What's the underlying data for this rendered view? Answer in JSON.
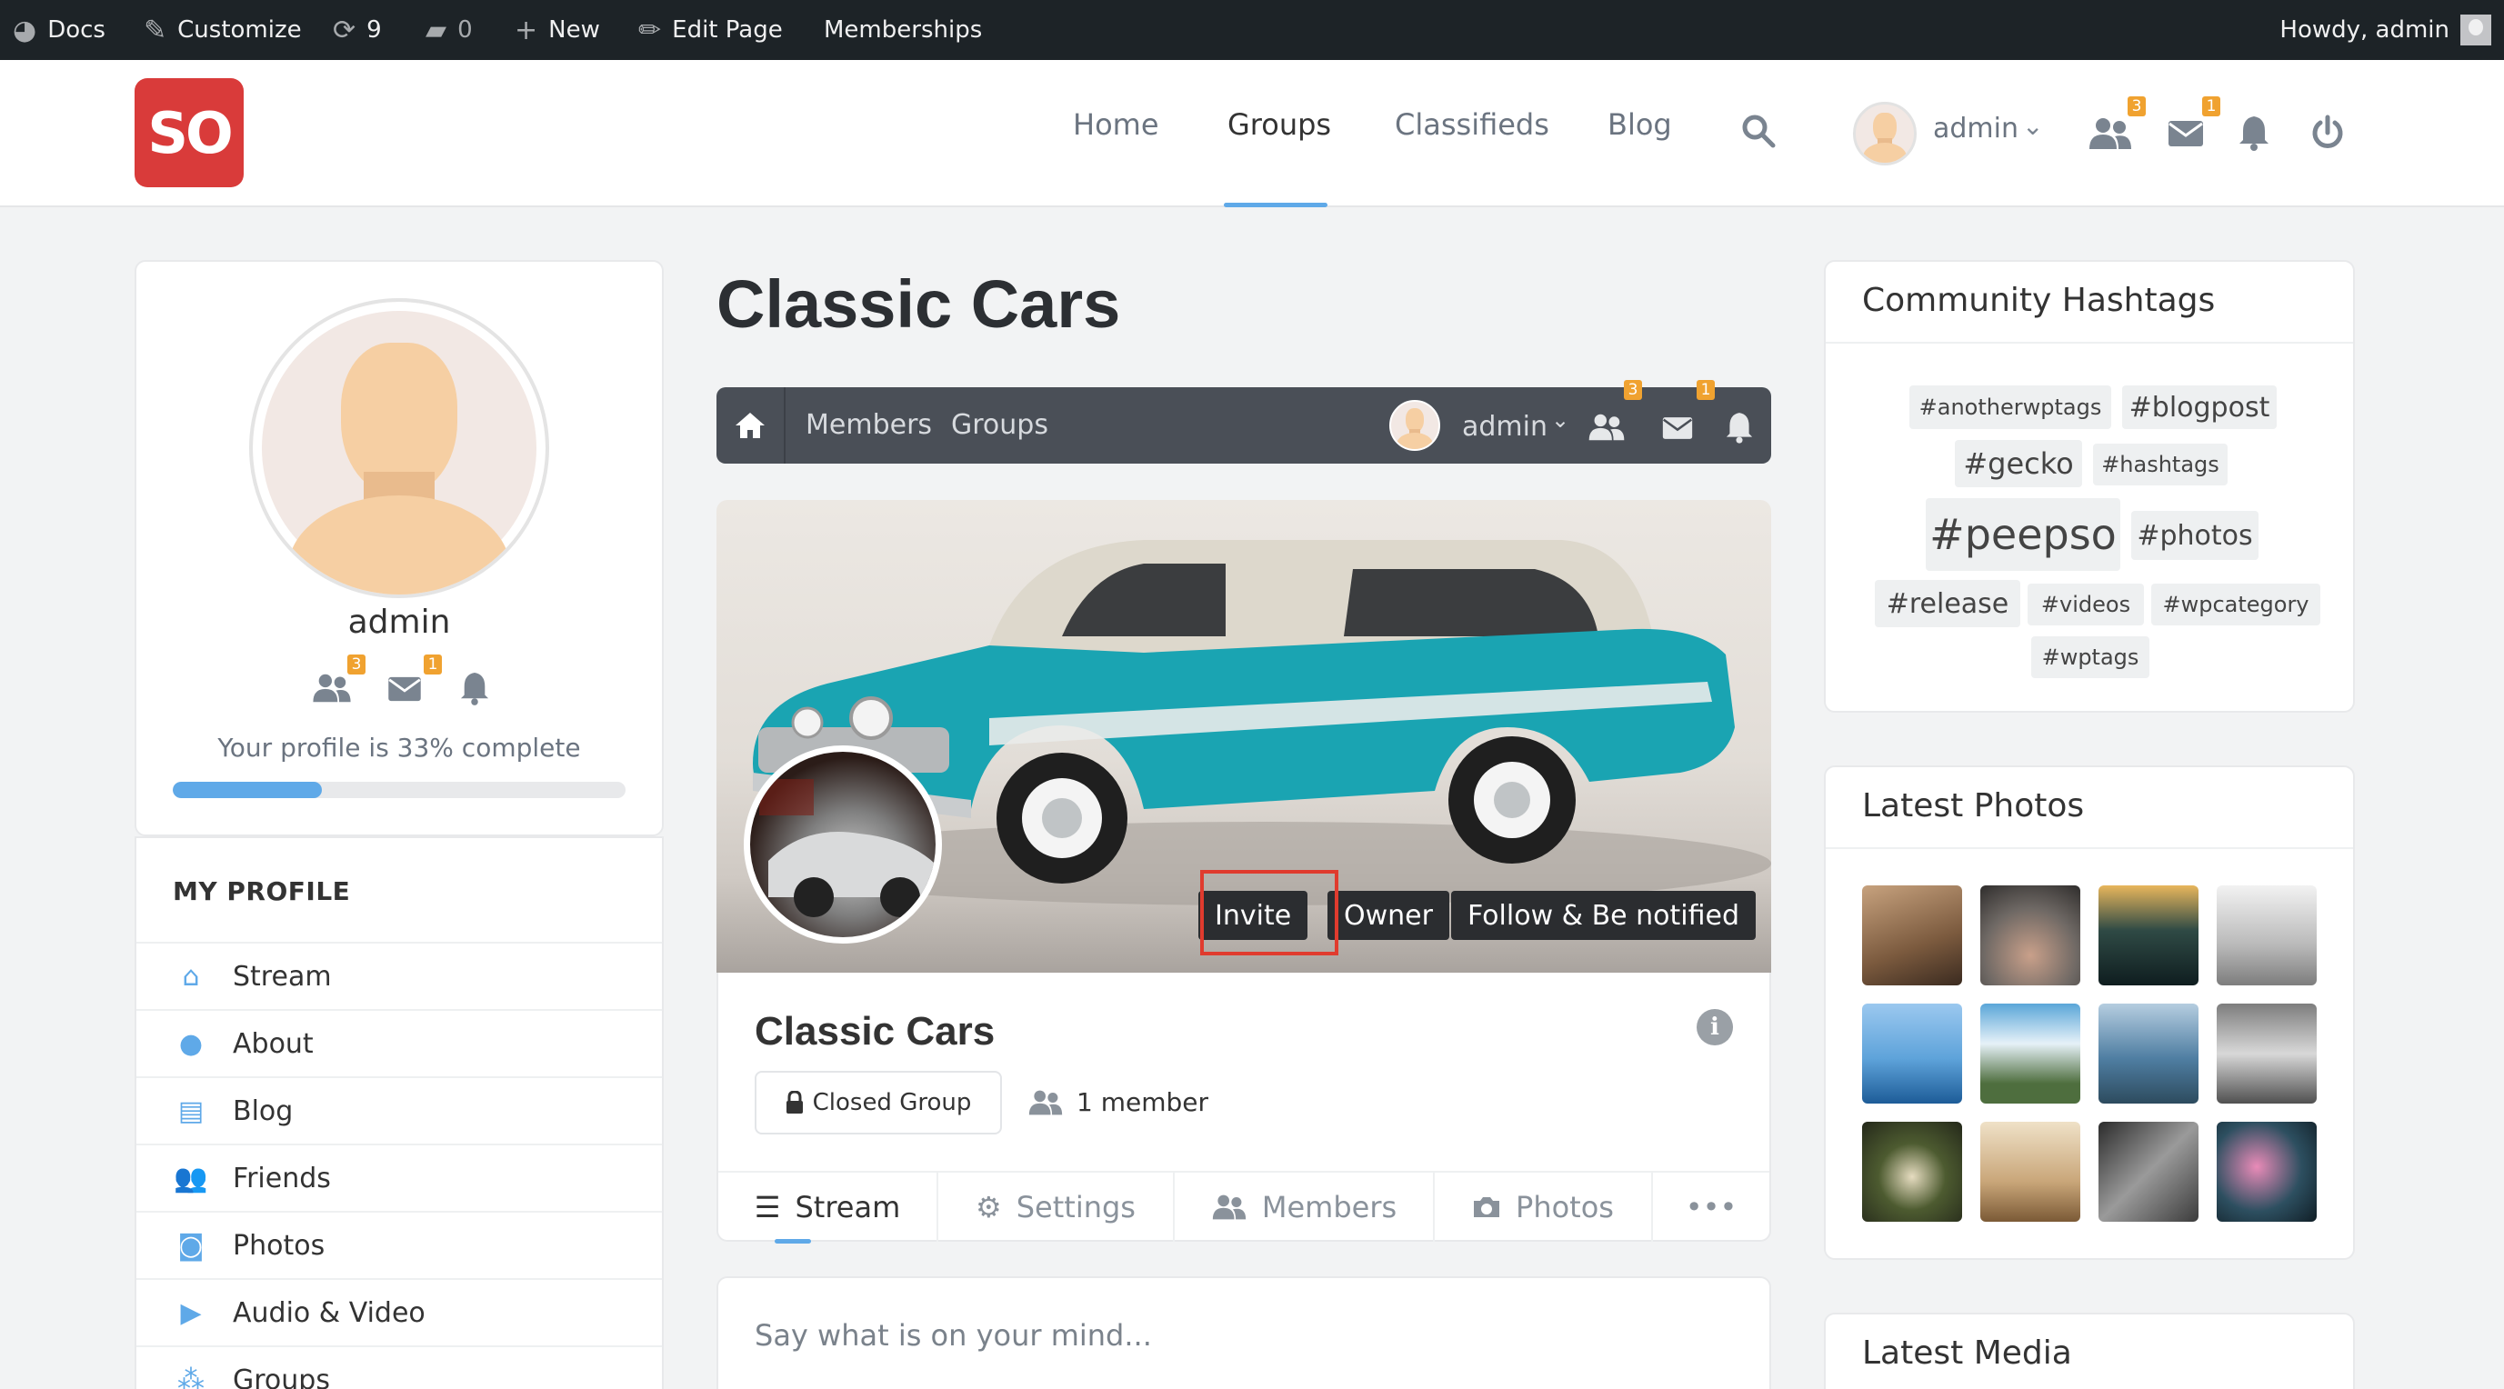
{
  "adminbar": {
    "docs": "Docs",
    "customize": "Customize",
    "updates": "9",
    "comments": "0",
    "new": "New",
    "edit_page": "Edit Page",
    "memberships": "Memberships",
    "howdy": "Howdy, admin"
  },
  "header": {
    "logo": "SO",
    "nav": [
      "Home",
      "Groups",
      "Classifieds",
      "Blog"
    ],
    "active_nav": "Groups",
    "user": "admin",
    "badges": {
      "friends": "3",
      "messages": "1"
    }
  },
  "profile": {
    "name": "admin",
    "badges": {
      "friends": "3",
      "messages": "1"
    },
    "completion_text": "Your profile is 33% complete",
    "completion_percent": 33,
    "menu_title": "MY PROFILE",
    "menu": [
      "Stream",
      "About",
      "Blog",
      "Friends",
      "Photos",
      "Audio & Video",
      "Groups"
    ]
  },
  "group": {
    "page_title": "Classic Cars",
    "bar": {
      "members": "Members",
      "groups": "Groups",
      "user": "admin",
      "badges": {
        "friends": "3",
        "messages": "1"
      }
    },
    "buttons": {
      "invite": "Invite",
      "owner": "Owner",
      "follow": "Follow & Be notified"
    },
    "name": "Classic Cars",
    "privacy": "Closed Group",
    "members": "1 member",
    "tabs": [
      "Stream",
      "Settings",
      "Members",
      "Photos"
    ],
    "more": "•••",
    "post_placeholder": "Say what is on your mind..."
  },
  "hashtags": {
    "title": "Community Hashtags",
    "tags": [
      "#anotherwptags",
      "#blogpost",
      "#gecko",
      "#hashtags",
      "#peepso",
      "#photos",
      "#release",
      "#videos",
      "#wpcategory",
      "#wptags"
    ]
  },
  "photos": {
    "title": "Latest Photos"
  },
  "media": {
    "title": "Latest Media"
  },
  "colors": {
    "accent": "#5fa9e8",
    "brand": "#d93b3a",
    "badge": "#f0a230",
    "dark_bar": "#4a4f57"
  }
}
